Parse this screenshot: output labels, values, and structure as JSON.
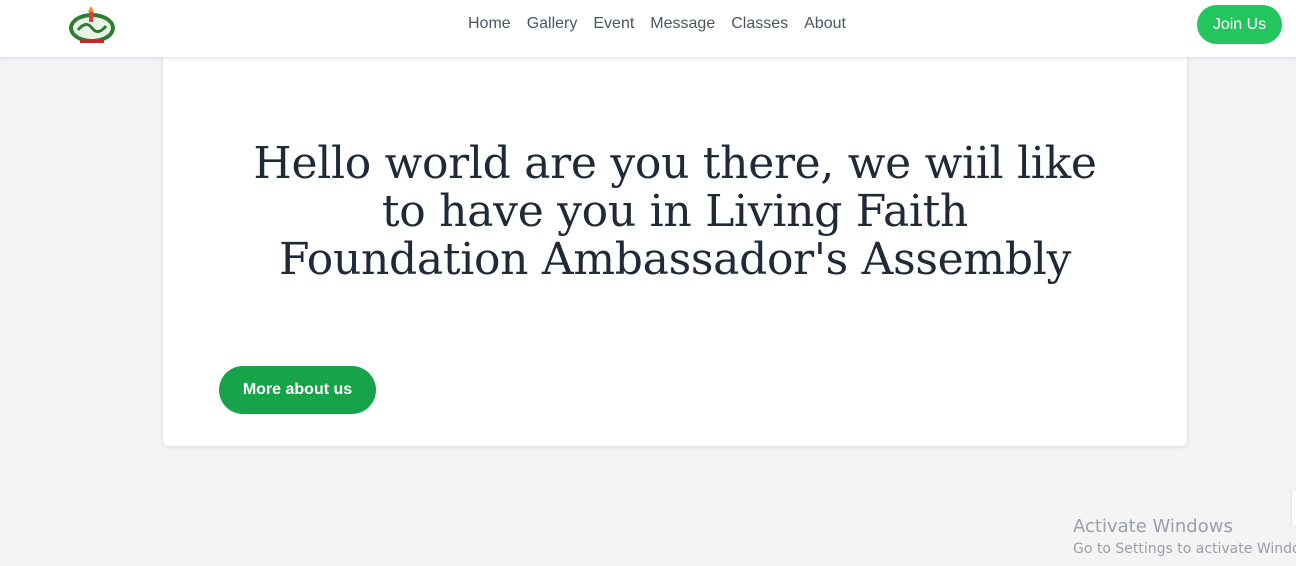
{
  "navbar": {
    "logo_icon": "lff-logo-icon",
    "links": [
      {
        "label": "Home"
      },
      {
        "label": "Gallery"
      },
      {
        "label": "Event"
      },
      {
        "label": "Message"
      },
      {
        "label": "Classes"
      },
      {
        "label": "About"
      }
    ],
    "join_label": "Join Us"
  },
  "hero": {
    "title_lines": [
      "Hello world are you there, we wiil like",
      "to have you in Living Faith",
      "Foundation Ambassador's Assembly"
    ],
    "button_label": "More about us"
  },
  "watermark": {
    "title": "Activate Windows",
    "subtitle": "Go to Settings to activate Windows."
  },
  "colors": {
    "accent": "#22c55e",
    "accent_dark": "#16a34a",
    "background": "#f3f4f6",
    "text_dark": "#1f2937",
    "nav_text": "#4b5563"
  }
}
